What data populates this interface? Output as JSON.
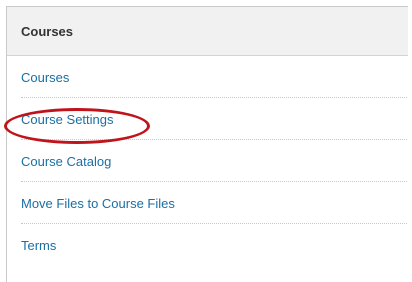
{
  "panel": {
    "title": "Courses",
    "items": [
      {
        "label": "Courses"
      },
      {
        "label": "Course Settings",
        "highlighted": true
      },
      {
        "label": "Course Catalog"
      },
      {
        "label": "Move Files to Course Files"
      },
      {
        "label": "Terms"
      }
    ]
  },
  "colors": {
    "link": "#1a6fa3",
    "highlight": "#c0141c",
    "header_bg": "#f1f1f1"
  }
}
